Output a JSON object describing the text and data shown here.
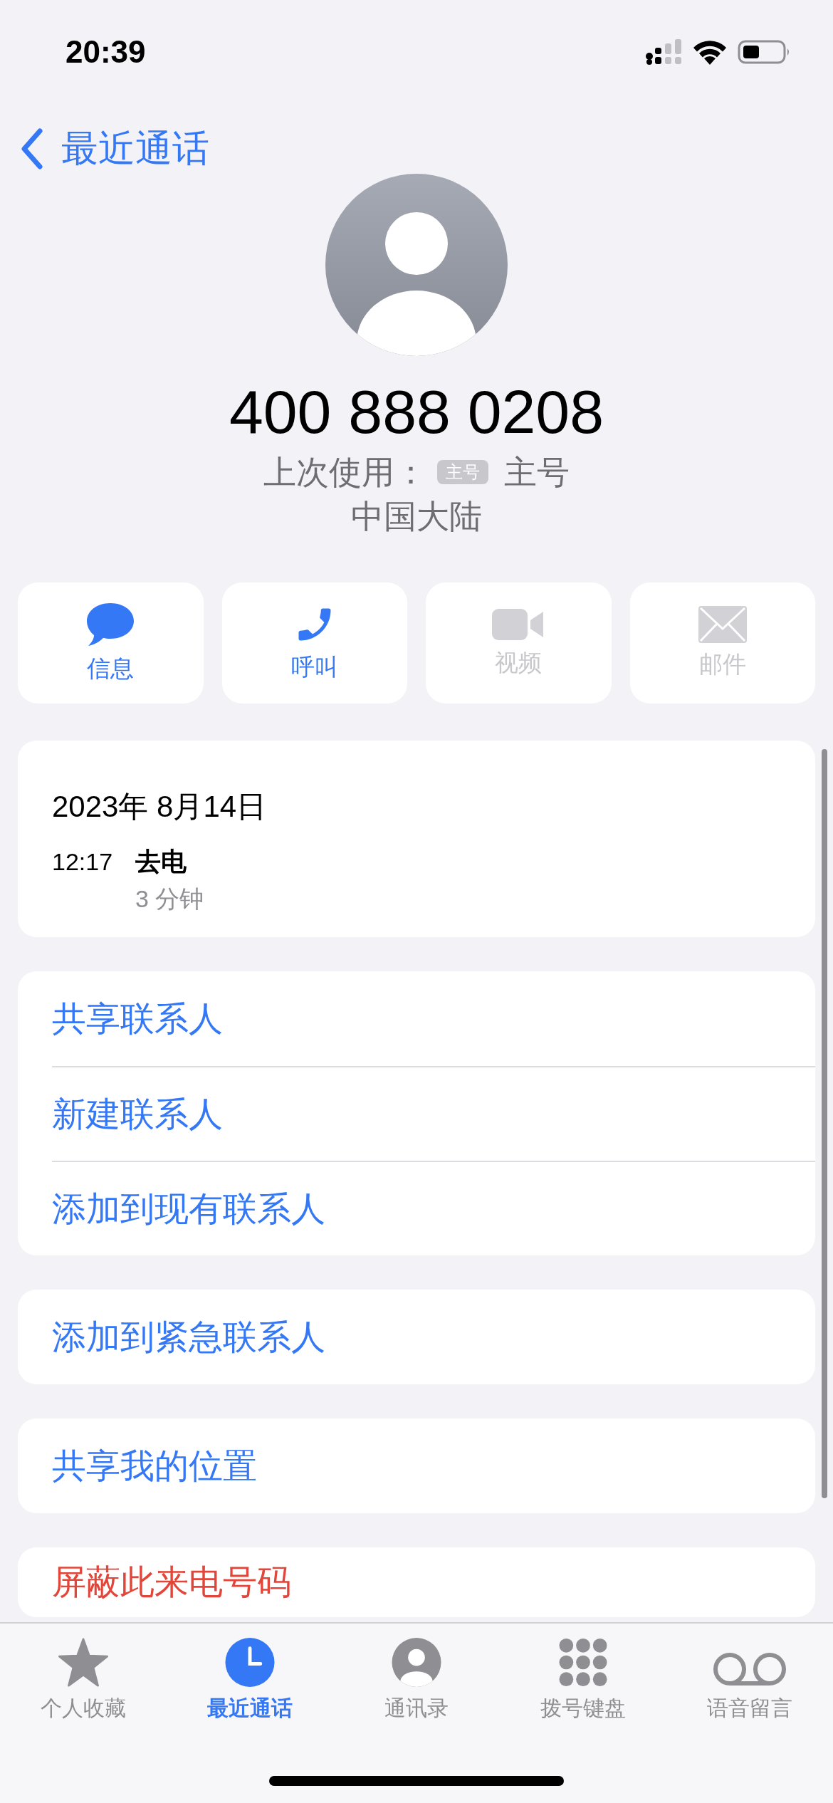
{
  "status_bar": {
    "time": "20:39"
  },
  "nav": {
    "back_label": "最近通话"
  },
  "contact": {
    "number": "400 888 0208",
    "last_used": {
      "label": "上次使用：",
      "badge": "主号",
      "value": "主号"
    },
    "region": "中国大陆"
  },
  "actions": [
    {
      "kind": "message",
      "label": "信息",
      "disabled": false
    },
    {
      "kind": "call",
      "label": "呼叫",
      "disabled": false
    },
    {
      "kind": "video",
      "label": "视频",
      "disabled": true
    },
    {
      "kind": "mail",
      "label": "邮件",
      "disabled": true
    }
  ],
  "history": {
    "date": "2023年 8月14日",
    "entries": [
      {
        "time": "12:17",
        "type": "去电",
        "duration": "3 分钟"
      }
    ]
  },
  "groups": [
    {
      "rows": [
        {
          "label": "共享联系人",
          "destructive": false
        },
        {
          "label": "新建联系人",
          "destructive": false
        },
        {
          "label": "添加到现有联系人",
          "destructive": false
        }
      ]
    },
    {
      "rows": [
        {
          "label": "添加到紧急联系人",
          "destructive": false
        }
      ]
    },
    {
      "rows": [
        {
          "label": "共享我的位置",
          "destructive": false
        }
      ]
    },
    {
      "rows": [
        {
          "label": "屏蔽此来电号码",
          "destructive": true
        }
      ]
    }
  ],
  "tab_bar": [
    {
      "kind": "favorites",
      "label": "个人收藏",
      "selected": false
    },
    {
      "kind": "recents",
      "label": "最近通话",
      "selected": true
    },
    {
      "kind": "contacts",
      "label": "通讯录",
      "selected": false
    },
    {
      "kind": "keypad",
      "label": "拨号键盘",
      "selected": false
    },
    {
      "kind": "voicemail",
      "label": "语音留言",
      "selected": false
    }
  ]
}
